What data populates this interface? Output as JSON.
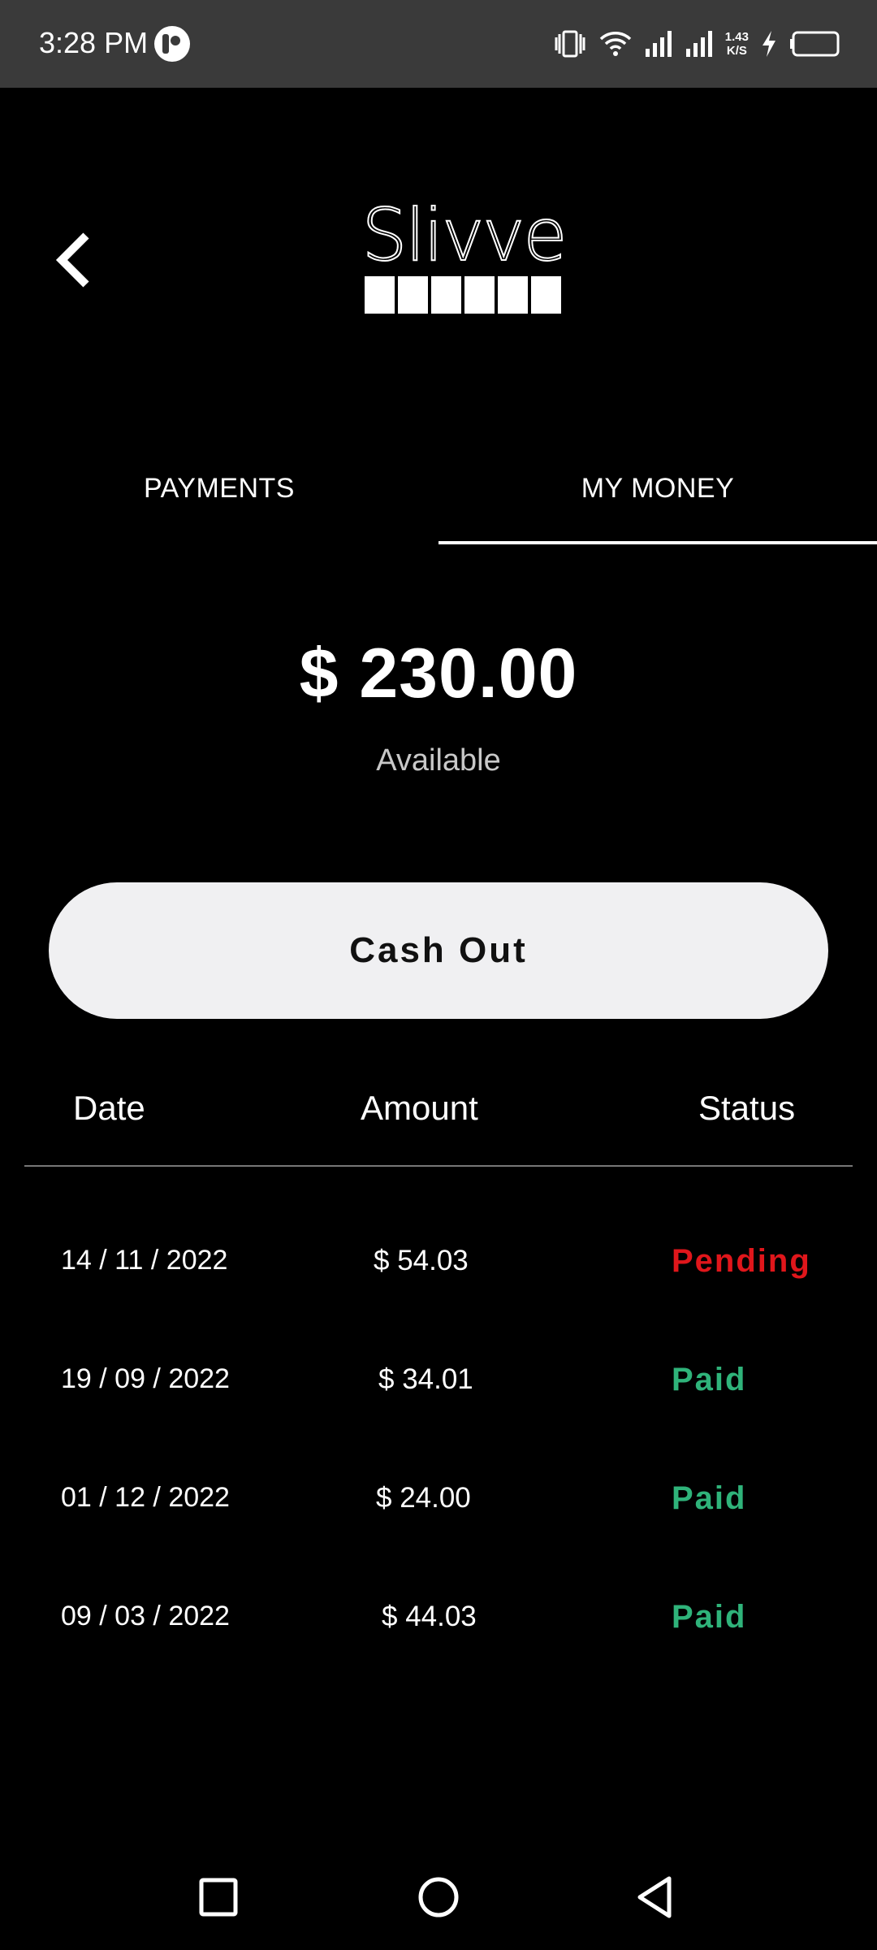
{
  "status_bar": {
    "time": "3:28 PM",
    "net_speed_value": "1.43",
    "net_speed_unit": "K/S"
  },
  "header": {
    "back_icon": "chevron-left-icon",
    "logo_text": "Slivve"
  },
  "tabs": [
    {
      "label": "PAYMENTS",
      "selected": false
    },
    {
      "label": "MY MONEY",
      "selected": true
    }
  ],
  "balance": {
    "amount": "$ 230.00",
    "label": "Available"
  },
  "cashout": {
    "label": "Cash Out"
  },
  "table": {
    "headers": {
      "date": "Date",
      "amount": "Amount",
      "status": "Status"
    },
    "rows": [
      {
        "date": "14 / 11 / 2022",
        "amount": "$ 54.03",
        "status": "Pending"
      },
      {
        "date": "19 / 09 / 2022",
        "amount": "$ 34.01",
        "status": "Paid"
      },
      {
        "date": "01 / 12 / 2022",
        "amount": "$ 24.00",
        "status": "Paid"
      },
      {
        "date": "09 / 03 / 2022",
        "amount": "$ 44.03",
        "status": "Paid"
      }
    ]
  },
  "colors": {
    "background": "#000000",
    "status_bar": "#3a3a3a",
    "button": "#f0f0f2",
    "pending": "#e0161b",
    "paid": "#2fb37a"
  },
  "nav_bar": {
    "recents_icon": "square-icon",
    "home_icon": "circle-icon",
    "back_icon": "triangle-back-icon"
  }
}
